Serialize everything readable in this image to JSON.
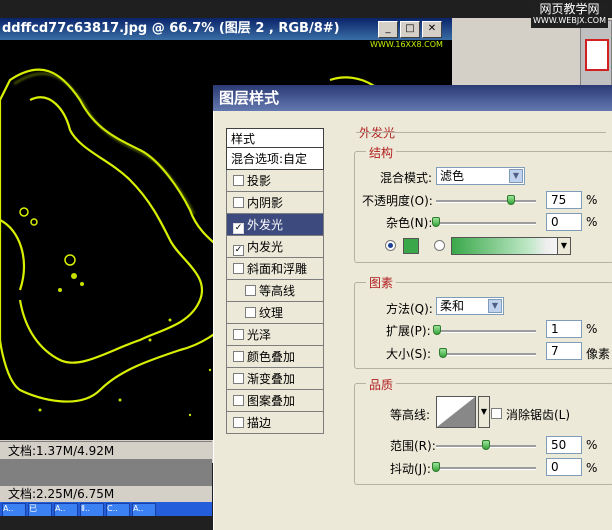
{
  "doc": {
    "title": "ddffcd77c63817.jpg @ 66.7% (图层 2 , RGB/8#)",
    "status1": "文档:1.37M/4.92M",
    "status2": "文档:2.25M/6.75M",
    "watermark": "WWW.16XX8.COM"
  },
  "logo": {
    "line1": "网页教学网",
    "line2": "WWW.WEBJX.COM"
  },
  "taskbar": [
    "A..",
    "已",
    "A..",
    "Ⅱ..",
    "C..",
    "A.."
  ],
  "dialog": {
    "title": "图层样式",
    "styles_header": "样式",
    "blend_options": "混合选项:自定",
    "items": [
      {
        "label": "投影",
        "checked": false,
        "sub": false,
        "selected": false
      },
      {
        "label": "内阴影",
        "checked": false,
        "sub": false,
        "selected": false
      },
      {
        "label": "外发光",
        "checked": true,
        "sub": false,
        "selected": true
      },
      {
        "label": "内发光",
        "checked": true,
        "sub": false,
        "selected": false
      },
      {
        "label": "斜面和浮雕",
        "checked": false,
        "sub": false,
        "selected": false
      },
      {
        "label": "等高线",
        "checked": false,
        "sub": true,
        "selected": false
      },
      {
        "label": "纹理",
        "checked": false,
        "sub": true,
        "selected": false
      },
      {
        "label": "光泽",
        "checked": false,
        "sub": false,
        "selected": false
      },
      {
        "label": "颜色叠加",
        "checked": false,
        "sub": false,
        "selected": false
      },
      {
        "label": "渐变叠加",
        "checked": false,
        "sub": false,
        "selected": false
      },
      {
        "label": "图案叠加",
        "checked": false,
        "sub": false,
        "selected": false
      },
      {
        "label": "描边",
        "checked": false,
        "sub": false,
        "selected": false
      }
    ],
    "outer_glow": "外发光",
    "structure": {
      "title": "结构",
      "blend_mode_label": "混合模式:",
      "blend_mode_value": "滤色",
      "opacity_label": "不透明度(O):",
      "opacity_value": "75",
      "opacity_fraction": 0.75,
      "noise_label": "杂色(N):",
      "noise_value": "0",
      "noise_fraction": 0,
      "percent": "%",
      "glow_color": "#3aa84a"
    },
    "elements": {
      "title": "图素",
      "method_label": "方法(Q):",
      "method_value": "柔和",
      "spread_label": "扩展(P):",
      "spread_value": "1",
      "spread_fraction": 0.01,
      "size_label": "大小(S):",
      "size_value": "7",
      "size_fraction": 0.028,
      "percent": "%",
      "px_unit": "像素"
    },
    "quality": {
      "title": "品质",
      "contour_label": "等高线:",
      "antialias_label": "消除锯齿(L)",
      "range_label": "范围(R):",
      "range_value": "50",
      "range_fraction": 0.5,
      "jitter_label": "抖动(J):",
      "jitter_value": "0",
      "jitter_fraction": 0,
      "percent": "%"
    }
  }
}
